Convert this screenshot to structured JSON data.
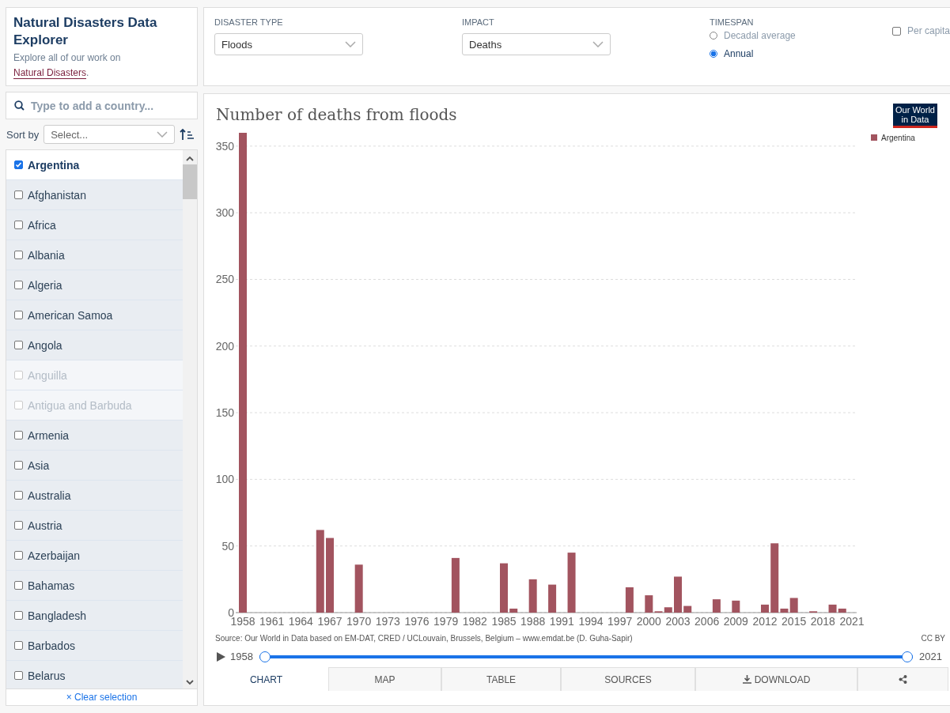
{
  "intro": {
    "title": "Natural Disasters Data Explorer",
    "text": "Explore all of our work on",
    "link": "Natural Disasters",
    "end": "."
  },
  "controls": [
    {
      "kind": "dropdown",
      "label": "DISASTER TYPE",
      "value": "Floods"
    },
    {
      "kind": "dropdown",
      "label": "IMPACT",
      "value": "Deaths"
    },
    {
      "kind": "radios",
      "label": "TIMESPAN",
      "options": [
        {
          "label": "Decadal average",
          "selected": false
        },
        {
          "label": "Annual",
          "selected": true
        }
      ]
    },
    {
      "kind": "checkbox",
      "label": "Per capita",
      "checked": false
    }
  ],
  "search": {
    "placeholder": "Type to add a country..."
  },
  "sort": {
    "label": "Sort by",
    "placeholder": "Select..."
  },
  "countries": [
    {
      "name": "Argentina",
      "checked": true,
      "disabled": false
    },
    {
      "name": "Afghanistan",
      "checked": false,
      "disabled": false
    },
    {
      "name": "Africa",
      "checked": false,
      "disabled": false
    },
    {
      "name": "Albania",
      "checked": false,
      "disabled": false
    },
    {
      "name": "Algeria",
      "checked": false,
      "disabled": false
    },
    {
      "name": "American Samoa",
      "checked": false,
      "disabled": false
    },
    {
      "name": "Angola",
      "checked": false,
      "disabled": false
    },
    {
      "name": "Anguilla",
      "checked": false,
      "disabled": true
    },
    {
      "name": "Antigua and Barbuda",
      "checked": false,
      "disabled": true
    },
    {
      "name": "Armenia",
      "checked": false,
      "disabled": false
    },
    {
      "name": "Asia",
      "checked": false,
      "disabled": false
    },
    {
      "name": "Australia",
      "checked": false,
      "disabled": false
    },
    {
      "name": "Austria",
      "checked": false,
      "disabled": false
    },
    {
      "name": "Azerbaijan",
      "checked": false,
      "disabled": false
    },
    {
      "name": "Bahamas",
      "checked": false,
      "disabled": false
    },
    {
      "name": "Bangladesh",
      "checked": false,
      "disabled": false
    },
    {
      "name": "Barbados",
      "checked": false,
      "disabled": false
    },
    {
      "name": "Belarus",
      "checked": false,
      "disabled": false
    }
  ],
  "clear": {
    "icon": "×",
    "label": "Clear selection"
  },
  "chart": {
    "logo": "Our World in Data",
    "source": "Source: Our World in Data based on EM-DAT, CRED / UCLouvain, Brussels, Belgium – www.emdat.be (D. Guha-Sapir)",
    "license": "CC BY",
    "chart_data": {
      "type": "bar",
      "title": "Number of deaths from floods",
      "categories": [
        "1958",
        null,
        null,
        "1961",
        null,
        null,
        "1964",
        null,
        null,
        "1967",
        null,
        null,
        "1970",
        null,
        null,
        "1973",
        null,
        null,
        "1976",
        null,
        null,
        "1979",
        null,
        null,
        "1982",
        null,
        null,
        "1985",
        null,
        null,
        "1988",
        null,
        null,
        "1991",
        null,
        null,
        "1994",
        null,
        null,
        "1997",
        null,
        null,
        "2000",
        null,
        null,
        "2003",
        null,
        null,
        "2006",
        null,
        null,
        "2009",
        null,
        null,
        "2012",
        null,
        null,
        "2015",
        null,
        null,
        "2018",
        null,
        null,
        "2021"
      ],
      "series": [
        {
          "name": "Argentina",
          "color": "#a2545f",
          "values": [
            360,
            null,
            null,
            null,
            null,
            null,
            null,
            null,
            62,
            56,
            null,
            null,
            36,
            null,
            null,
            null,
            null,
            null,
            null,
            null,
            null,
            null,
            41,
            null,
            null,
            null,
            null,
            37,
            3,
            null,
            25,
            null,
            21,
            null,
            45,
            null,
            null,
            null,
            null,
            null,
            19,
            null,
            13,
            1,
            4,
            27,
            5,
            null,
            null,
            10,
            null,
            9,
            null,
            null,
            6,
            52,
            3,
            11,
            null,
            1,
            null,
            6,
            3,
            null
          ]
        }
      ],
      "grid": true,
      "yticks": [
        0,
        50,
        100,
        150,
        200,
        250,
        300,
        350
      ],
      "ylim": [
        0,
        360
      ]
    }
  },
  "timeline": {
    "start": "1958",
    "end": "2021",
    "level": 1
  },
  "tabs": [
    {
      "label": "CHART",
      "kind": "text",
      "selected": true
    },
    {
      "label": "MAP",
      "kind": "text",
      "selected": false
    },
    {
      "label": "TABLE",
      "kind": "text",
      "selected": false
    },
    {
      "label": "SOURCES",
      "kind": "text",
      "selected": false
    },
    {
      "label": "DOWNLOAD",
      "kind": "download",
      "selected": false
    },
    {
      "kind": "share",
      "selected": false
    }
  ]
}
